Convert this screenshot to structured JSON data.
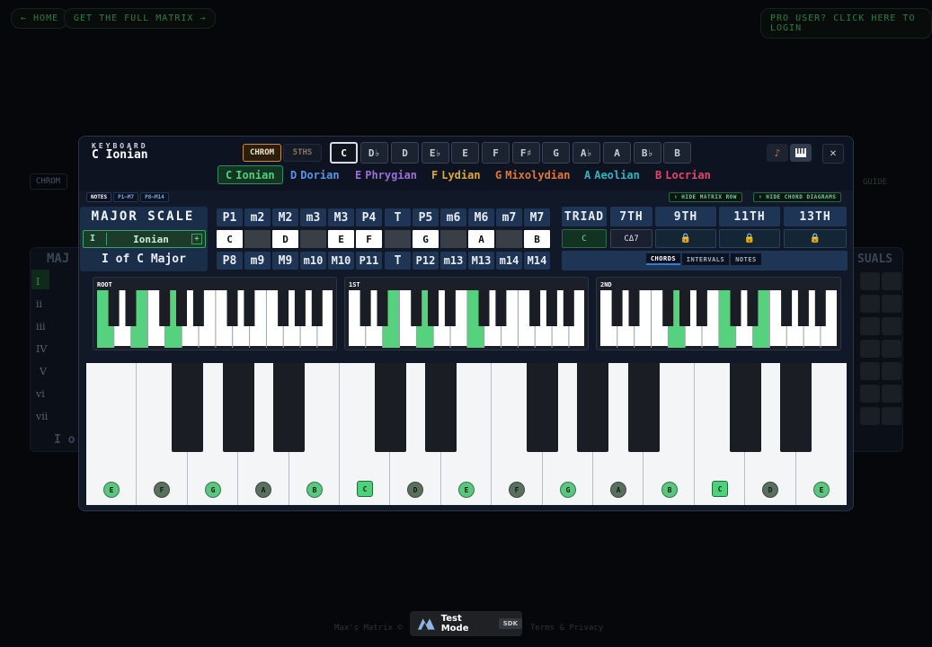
{
  "background": {
    "nav_home": "← HOME",
    "nav_matrix": "GET THE FULL MATRIX →",
    "nav_login": "PRO USER? CLICK HERE TO LOGIN",
    "chrom_tab": "CHROM",
    "guide_text": "GUIDE",
    "major_heading": "MAJ",
    "visuals_heading": "SUALS",
    "roman_rows": [
      "I",
      "ii",
      "iii",
      "IV",
      "V",
      "vi",
      "vii"
    ],
    "bottom_fragment": "I o",
    "footer_left": "Max's Matrix ©",
    "footer_right": "Terms & Privacy"
  },
  "modal": {
    "caption": "KEYBOARD",
    "title": "C Ionian",
    "modes_toggle": [
      "CHROM",
      "5THS"
    ],
    "keys": [
      "C",
      "D♭",
      "D",
      "E♭",
      "E",
      "F",
      "F♯",
      "G",
      "A♭",
      "A",
      "B♭",
      "B"
    ],
    "active_key": "C",
    "close_label": "✕",
    "guitar_icon": "guitar-icon",
    "piano_icon": "piano-icon",
    "mode_names": [
      {
        "letter": "C",
        "name": "Ionian",
        "color": "#4fd17b"
      },
      {
        "letter": "D",
        "name": "Dorian",
        "color": "#5b93e8"
      },
      {
        "letter": "E",
        "name": "Phrygian",
        "color": "#9b6fd6"
      },
      {
        "letter": "F",
        "name": "Lydian",
        "color": "#e0a730"
      },
      {
        "letter": "G",
        "name": "Mixolydian",
        "color": "#e0763a"
      },
      {
        "letter": "A",
        "name": "Aeolian",
        "color": "#2fb5c2"
      },
      {
        "letter": "B",
        "name": "Locrian",
        "color": "#e0476a"
      }
    ],
    "tabs": [
      "NOTES",
      "P1–M7",
      "P8–M14"
    ],
    "hide_matrix_row": "⬆ HIDE MATRIX ROW",
    "hide_chord_diagrams": "⬆ HIDE CHORD DIAGRAMS",
    "scale_title": "MAJOR SCALE",
    "scale_degree": "I",
    "scale_mode": "Ionian",
    "scale_plus": "+",
    "scale_sub": "I of C Major",
    "intervals_top": [
      "P1",
      "m2",
      "M2",
      "m3",
      "M3",
      "P4",
      "T",
      "P5",
      "m6",
      "M6",
      "m7",
      "M7"
    ],
    "intervals_bottom": [
      "P8",
      "m9",
      "M9",
      "m10",
      "M10",
      "P11",
      "T",
      "P12",
      "m13",
      "M13",
      "m14",
      "M14"
    ],
    "notes_row": [
      "C",
      "",
      "D",
      "",
      "E",
      "F",
      "",
      "G",
      "",
      "A",
      "",
      "B"
    ],
    "chord_heads": [
      "TRIAD",
      "7TH",
      "9TH",
      "11TH",
      "13TH"
    ],
    "chord_triad": "C",
    "chord_7th": "CΔ7",
    "lock_icon": "🔒",
    "segments": [
      "CHORDS",
      "INTERVALS",
      "NOTES"
    ],
    "mini_labels": [
      "ROOT",
      "1ST",
      "2ND"
    ],
    "big_notes": [
      "E",
      "F",
      "G",
      "A",
      "B",
      "C",
      "D",
      "E",
      "F",
      "G",
      "A",
      "B",
      "C",
      "D",
      "E"
    ],
    "active_color": "#4fd17b"
  },
  "test_mode": {
    "label": "Test Mode",
    "sdk": "SDK"
  }
}
